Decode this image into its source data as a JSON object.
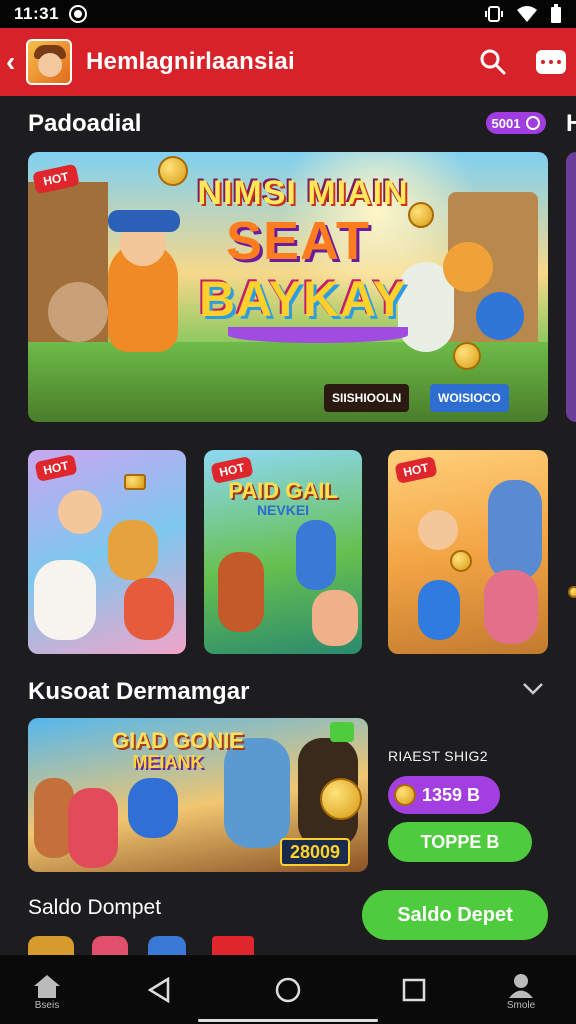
{
  "status_bar": {
    "time": "11:31"
  },
  "app_bar": {
    "title": "Hemlagnirlaansiai"
  },
  "featured": {
    "section_title": "Padoadial",
    "badge": "5001",
    "edge_letter": "H",
    "hero": {
      "line1": "NIMSI MIAIN",
      "line2": "SEAT",
      "line3": "BAYKAY",
      "chip_left": "SIISHIOOLN",
      "chip_right": "WOISIOCO"
    },
    "tiles": [
      {
        "title": ""
      },
      {
        "title": "PAID GAIL",
        "subtitle": "NEVKEI"
      },
      {
        "title": ""
      }
    ]
  },
  "recommended": {
    "section_title": "Kusoat Dermamgar",
    "banner": {
      "line1": "GIAD GONIE",
      "line2": "MEIANK",
      "price": "28009"
    },
    "side_label": "RIAEST SHIG2",
    "coin_amount": "1359 B",
    "topup_label": "TOPPE B"
  },
  "wallet": {
    "title": "Saldo Dompet",
    "button_label": "Saldo Depet"
  },
  "bottom_nav": {
    "home_label": "Bseis",
    "profile_label": "Smole"
  },
  "colors": {
    "brand_red": "#d8222a",
    "accent_purple": "#a33fe0",
    "action_green": "#4fcc3e",
    "background": "#1d1d1f"
  }
}
